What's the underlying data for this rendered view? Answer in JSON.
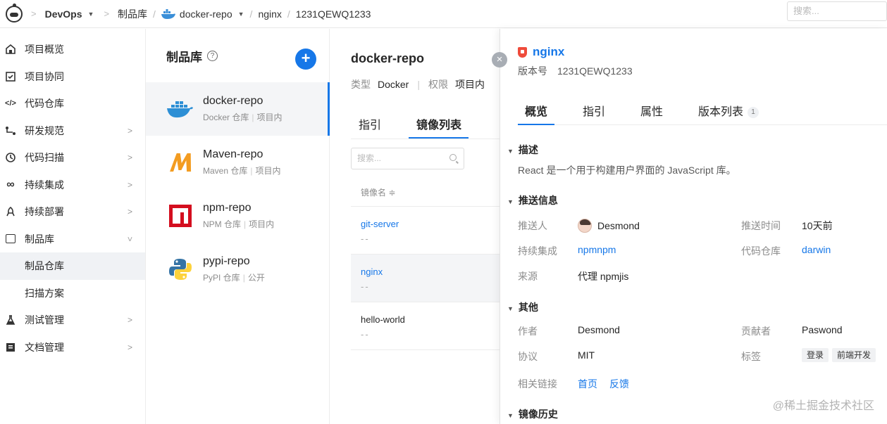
{
  "topbar": {
    "org": "DevOps",
    "crumbs": [
      "制品库",
      "docker-repo",
      "nginx",
      "1231QEWQ1233"
    ],
    "search_placeholder": "搜索..."
  },
  "sidebar": {
    "items": [
      {
        "label": "项目概览",
        "icon": "home-icon"
      },
      {
        "label": "项目协同",
        "icon": "check-board-icon"
      },
      {
        "label": "代码仓库",
        "icon": "code-icon"
      },
      {
        "label": "研发规范",
        "icon": "flow-icon",
        "chevron": "right"
      },
      {
        "label": "代码扫描",
        "icon": "scan-icon",
        "chevron": "right"
      },
      {
        "label": "持续集成",
        "icon": "infinity-icon",
        "chevron": "right"
      },
      {
        "label": "持续部署",
        "icon": "rocket-icon",
        "chevron": "right"
      },
      {
        "label": "制品库",
        "icon": "box-icon",
        "chevron": "down"
      },
      {
        "label": "制品仓库",
        "sub": true,
        "active": true
      },
      {
        "label": "扫描方案",
        "sub": true
      },
      {
        "label": "测试管理",
        "icon": "flask-icon",
        "chevron": "right"
      },
      {
        "label": "文档管理",
        "icon": "doc-icon",
        "chevron": "right"
      }
    ]
  },
  "repos": {
    "title": "制品库",
    "help_glyph": "?",
    "add_glyph": "+",
    "items": [
      {
        "name": "docker-repo",
        "type": "Docker 仓库",
        "scope": "项目内",
        "icon": "docker-icon",
        "active": true
      },
      {
        "name": "Maven-repo",
        "type": "Maven 仓库",
        "scope": "项目内",
        "icon": "maven-icon"
      },
      {
        "name": "npm-repo",
        "type": "NPM 仓库",
        "scope": "项目内",
        "icon": "npm-icon"
      },
      {
        "name": "pypi-repo",
        "type": "PyPI 仓库",
        "scope": "公开",
        "icon": "python-icon"
      }
    ]
  },
  "mid": {
    "title": "docker-repo",
    "type_key": "类型",
    "type_val": "Docker",
    "perm_key": "权限",
    "perm_val": "项目内",
    "tabs": [
      "指引",
      "镜像列表"
    ],
    "search_placeholder": "搜索...",
    "col_header": "镜像名 ≑",
    "images": [
      {
        "name": "git-server",
        "sub": "--"
      },
      {
        "name": "nginx",
        "sub": "--",
        "active": true
      },
      {
        "name": "hello-world",
        "sub": "--"
      }
    ]
  },
  "detail": {
    "close_glyph": "×",
    "title": "nginx",
    "version_key": "版本号",
    "version": "1231QEWQ1233",
    "tabs": [
      "概览",
      "指引",
      "属性",
      "版本列表"
    ],
    "version_count": "1",
    "sections": {
      "desc": "描述",
      "push": "推送信息",
      "other": "其他",
      "history": "镜像历史"
    },
    "description": "React 是一个用于构建用户界面的 JavaScript 库。",
    "push": {
      "pusher_key": "推送人",
      "pusher": "Desmond",
      "time_key": "推送时间",
      "time": "10天前",
      "ci_key": "持续集成",
      "ci": "npmnpm",
      "repo_key": "代码仓库",
      "repo": "darwin",
      "source_key": "来源",
      "source": "代理 npmjis"
    },
    "other": {
      "author_key": "作者",
      "author": "Desmond",
      "contrib_key": "贡献者",
      "contrib": "Paswond",
      "license_key": "协议",
      "license": "MIT",
      "tags_key": "标签",
      "tags": [
        "登录",
        "前端开发"
      ],
      "links_key": "相关链接",
      "links": [
        "首页",
        "反馈"
      ]
    }
  },
  "watermark": "@稀土掘金技术社区",
  "colors": {
    "accent": "#1677e8",
    "danger": "#ef4b3b"
  }
}
